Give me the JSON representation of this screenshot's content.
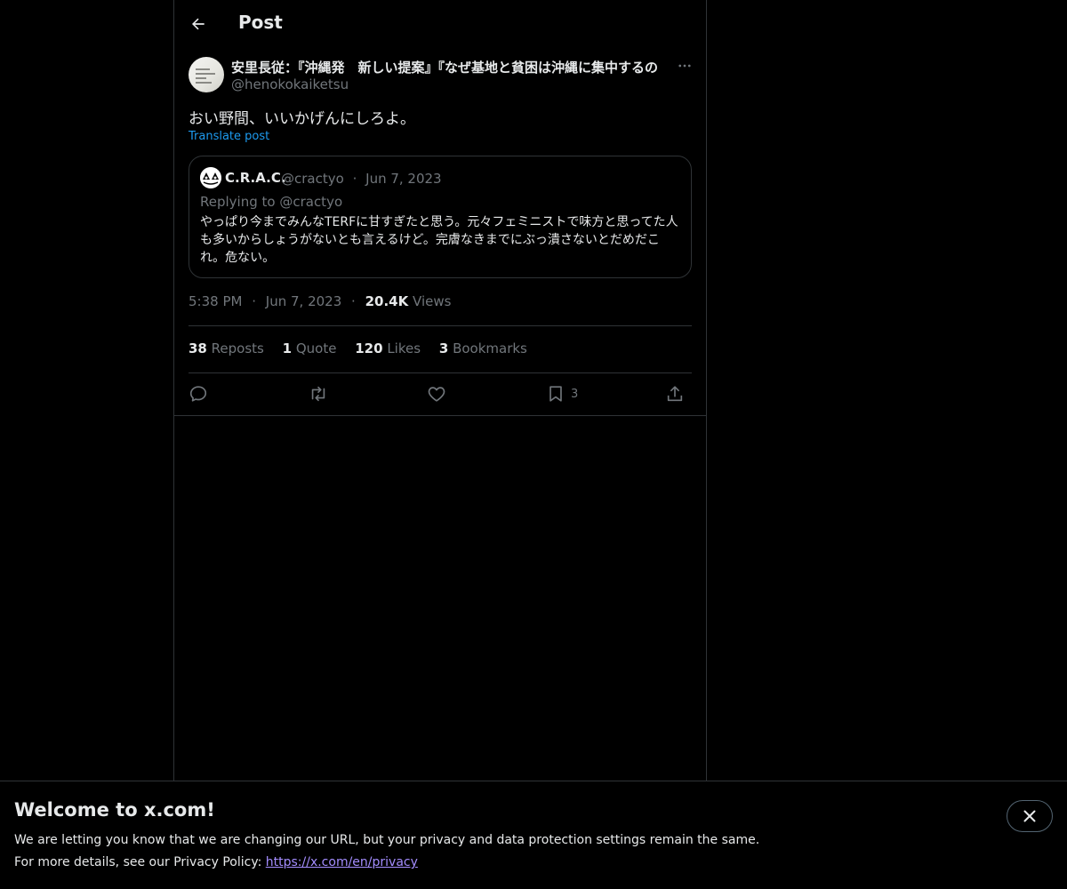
{
  "header": {
    "title": "Post"
  },
  "post": {
    "author_name": "安里長従：『沖縄発　新しい提案』『なぜ基地と貧困は沖縄に集中するの",
    "author_handle": "@henokokaiketsu",
    "text": "おい野間、いいかげんにしろよ。",
    "translate_label": "Translate post",
    "time": "5:38 PM",
    "date": "Jun 7, 2023",
    "views_count": "20.4K",
    "views_label": "Views",
    "separator": "·"
  },
  "quote": {
    "name": "C.R.A.C.",
    "handle": "@cractyo",
    "separator": "·",
    "date": "Jun 7, 2023",
    "replying_to": "Replying to @cractyo",
    "text": "やっぱり今までみんなTERFに甘すぎたと思う。元々フェミニストで味方と思ってた人も多いからしょうがないとも言えるけど。完膚なきまでにぶっ潰さないとだめだこれ。危ない。"
  },
  "stats": {
    "reposts_count": "38",
    "reposts_label": "Reposts",
    "quotes_count": "1",
    "quotes_label": "Quote",
    "likes_count": "120",
    "likes_label": "Likes",
    "bookmarks_count": "3",
    "bookmarks_label": "Bookmarks"
  },
  "actions": {
    "bookmark_count": "3",
    "icons": [
      "reply-icon",
      "repost-icon",
      "like-icon",
      "bookmark-icon",
      "share-icon"
    ]
  },
  "banner": {
    "title": "Welcome to x.com!",
    "line1": "We are letting you know that we are changing our URL, but your privacy and data protection settings remain the same.",
    "line2_prefix": "For more details, see our Privacy Policy: ",
    "link": "https://x.com/en/privacy"
  },
  "colors": {
    "background": "#000000",
    "text": "#e7e9ea",
    "muted": "#71767b",
    "accent": "#1d9bf0",
    "border": "#2f3336",
    "link": "#a48dff"
  }
}
